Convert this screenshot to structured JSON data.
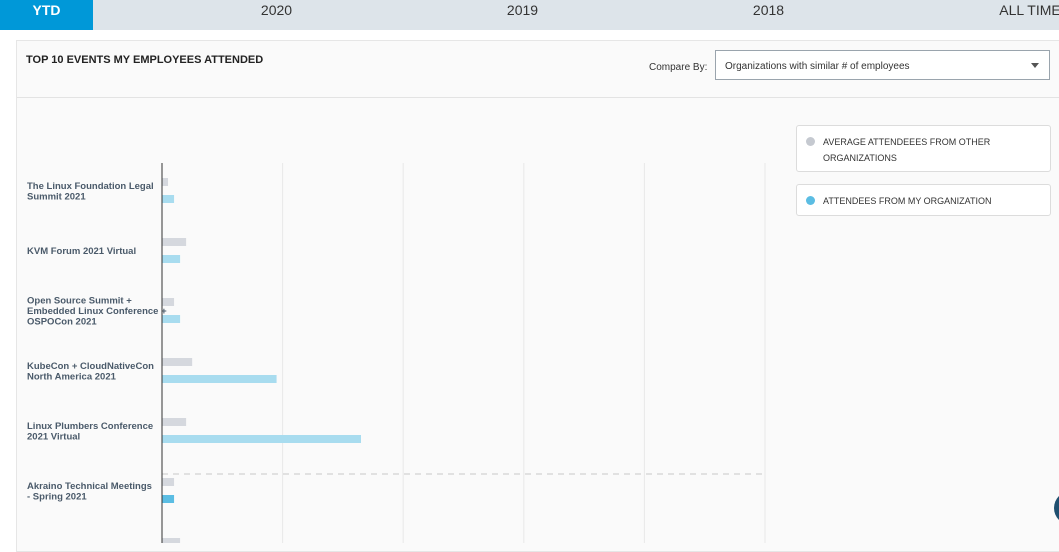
{
  "tabs": [
    {
      "label": "YTD",
      "active": true
    },
    {
      "label": "2020",
      "active": false
    },
    {
      "label": "2019",
      "active": false
    },
    {
      "label": "2018",
      "active": false
    },
    {
      "label": "ALL TIME",
      "active": false
    }
  ],
  "panel": {
    "title": "TOP 10 EVENTS MY EMPLOYEES ATTENDED",
    "compare_label": "Compare By:",
    "compare_selected": "Organizations with similar # of employees"
  },
  "legend": [
    {
      "label": "AVERAGE ATTENDEEES FROM OTHER ORGANIZATIONS",
      "color": "#c5c9d0"
    },
    {
      "label": "ATTENDEES FROM MY ORGANIZATION",
      "color": "#5bbde3"
    }
  ],
  "chart_data": {
    "type": "bar",
    "orientation": "horizontal",
    "categories": [
      "The Linux Foundation Legal Summit 2021",
      "KVM Forum 2021 Virtual",
      "Open Source Summit + Embedded Linux Conference + OSPOCon 2021",
      "KubeCon + CloudNativeCon North America 2021",
      "Linux Plumbers Conference 2021 Virtual",
      "Akraino Technical Meetings - Spring 2021",
      ""
    ],
    "series": [
      {
        "name": "AVERAGE ATTENDEEES FROM OTHER ORGANIZATIONS",
        "color": "#d5d8de",
        "values": [
          0.5,
          2,
          1,
          2.5,
          2,
          1,
          1.5
        ]
      },
      {
        "name": "ATTENDEES FROM MY ORGANIZATION",
        "color": "#a8dcef",
        "highlight_color": "#5bbde3",
        "values": [
          1,
          1.5,
          1.5,
          9.5,
          16.5,
          1,
          null
        ]
      }
    ],
    "xlim": [
      0,
      50
    ],
    "grid": true,
    "legend_position": "right",
    "dashed_separator_after_index": 4
  }
}
